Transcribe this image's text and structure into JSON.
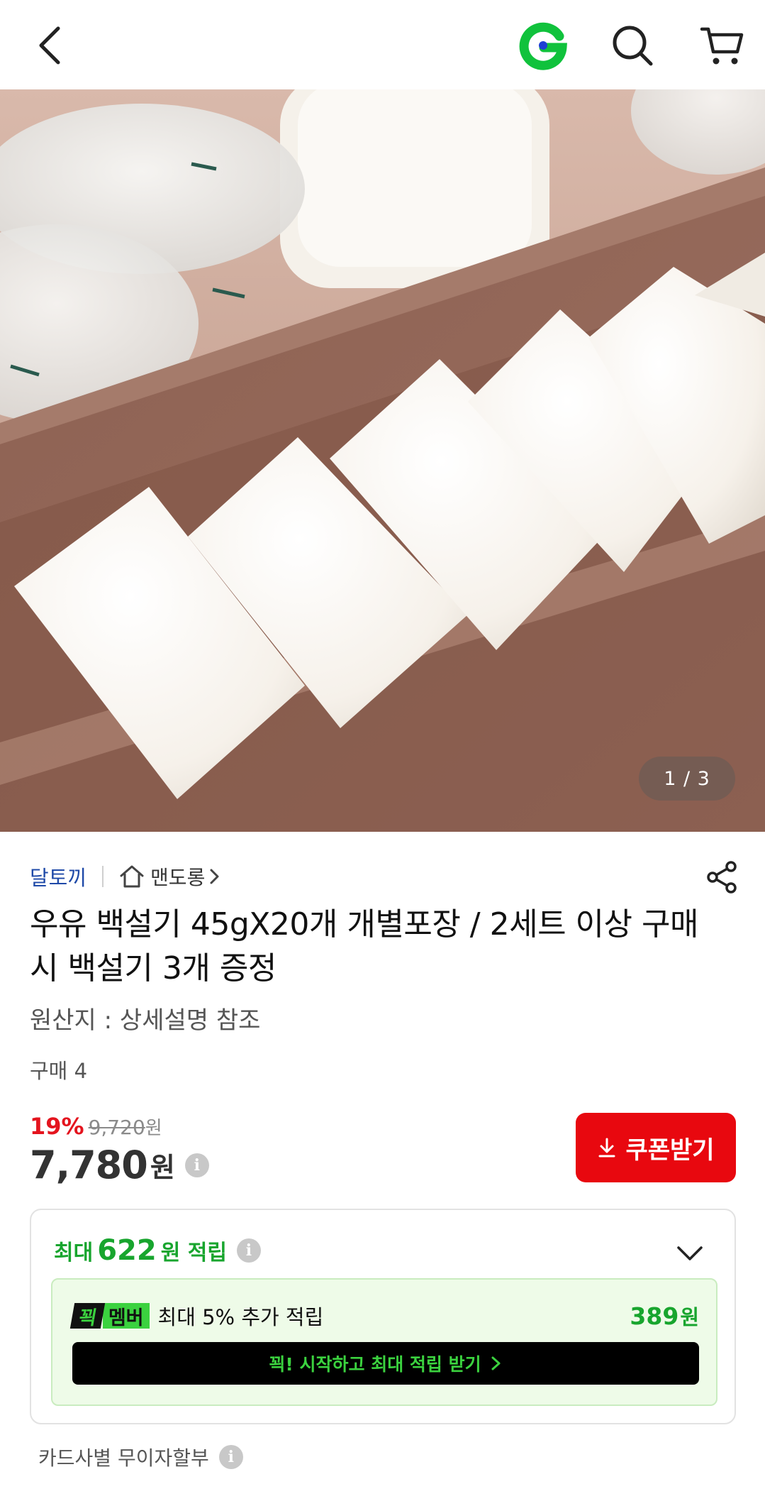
{
  "header": {
    "back_icon": "chevron-left-icon",
    "logo_icon": "gmarket-g-logo-icon",
    "search_icon": "search-icon",
    "cart_icon": "cart-icon",
    "brand_green": "#00b33c"
  },
  "gallery": {
    "counter": "1 / 3",
    "current_image": 1,
    "total_images": 3
  },
  "product": {
    "seller": "달토끼",
    "store_name": "맨도롱",
    "title": "우유 백설기 45gX20개 개별포장 / 2세트 이상 구매 시 백설기 3개 증정",
    "origin": "원산지 : 상세설명 참조",
    "purchase_count": "구매 4"
  },
  "pricing": {
    "discount": "19%",
    "original_price": "9,720",
    "original_unit": "원",
    "price": "7,780",
    "price_unit": "원",
    "coupon_label": "쿠폰받기",
    "accent_red": "#e8080f"
  },
  "points": {
    "prefix": "최대",
    "value": "622",
    "suffix": "원 적립",
    "member_badge_k": "꾁",
    "member_badge_m": "멤버",
    "member_text": "최대 5% 추가 적립",
    "member_amount": "389",
    "member_unit": "원",
    "start_label": "꾁! 시작하고 최대 적립 받기",
    "accent_green": "#18a52e"
  },
  "installment": {
    "label": "카드사별 무이자할부"
  }
}
